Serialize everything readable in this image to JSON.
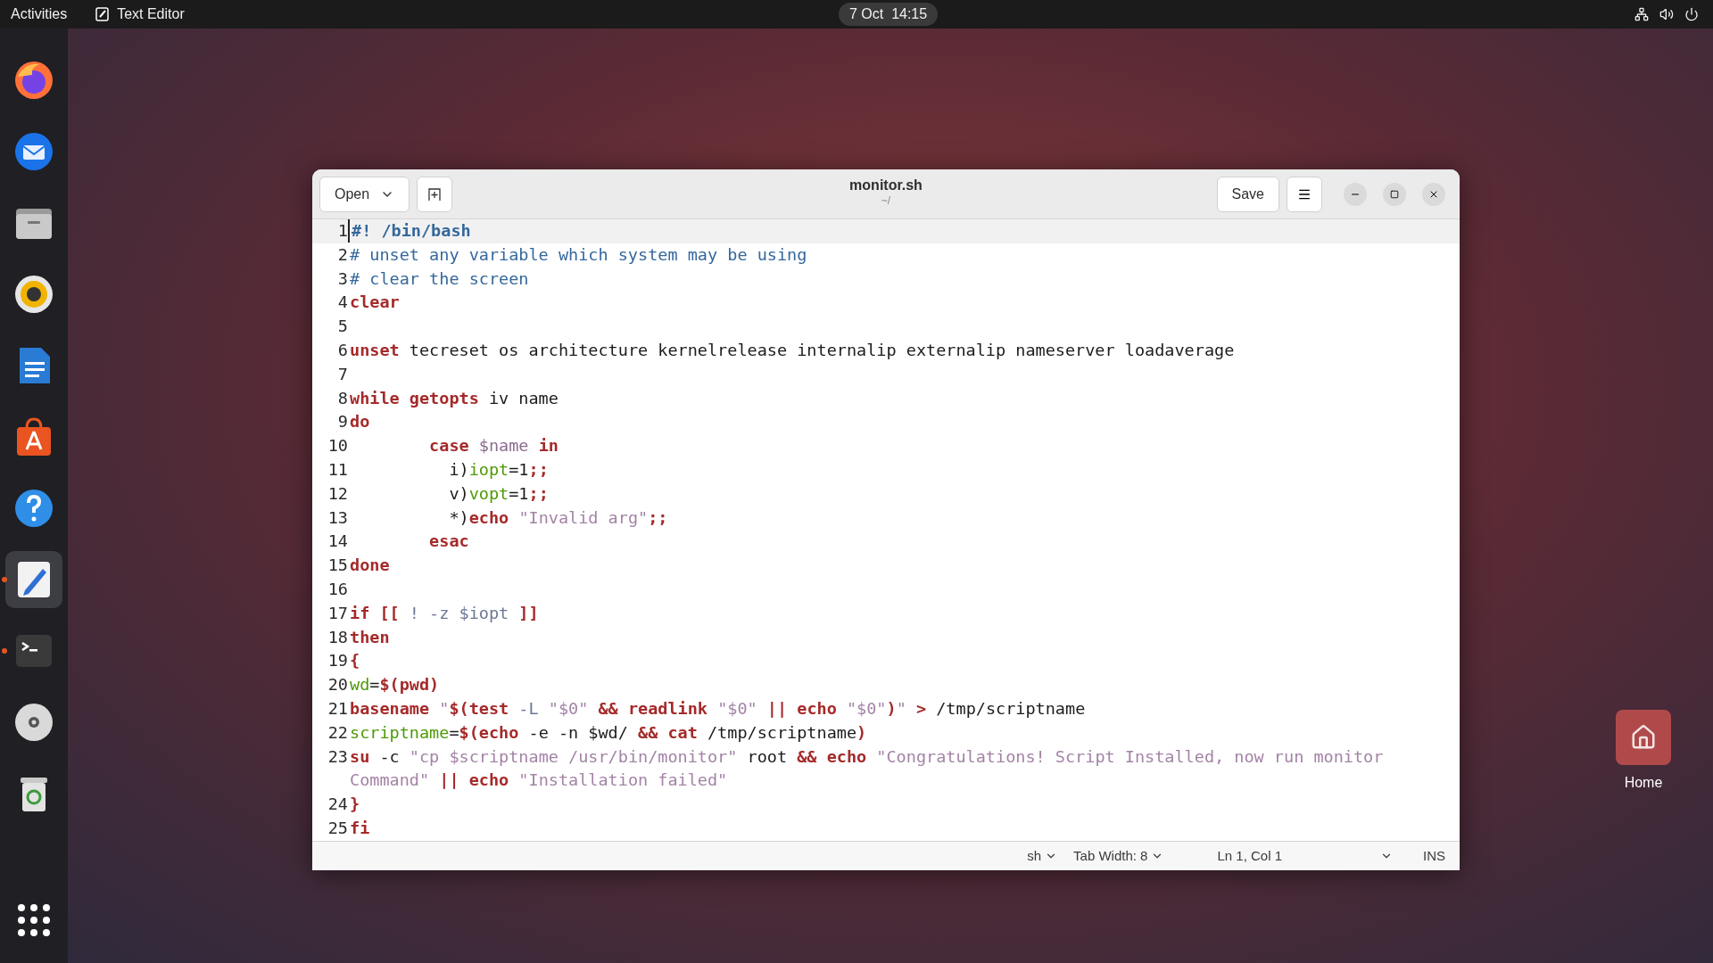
{
  "top_bar": {
    "activities": "Activities",
    "app_name": "Text Editor",
    "clock": "7 Oct  14:15"
  },
  "dock": [
    {
      "kind": "browser",
      "running": false,
      "focused": false
    },
    {
      "kind": "mail",
      "running": false,
      "focused": false
    },
    {
      "kind": "files",
      "running": false,
      "focused": false
    },
    {
      "kind": "music",
      "running": false,
      "focused": false
    },
    {
      "kind": "document",
      "running": false,
      "focused": false
    },
    {
      "kind": "store",
      "running": false,
      "focused": false
    },
    {
      "kind": "help",
      "running": false,
      "focused": false
    },
    {
      "kind": "editor",
      "running": true,
      "focused": true
    },
    {
      "kind": "terminal",
      "running": true,
      "focused": false
    },
    {
      "kind": "disc",
      "running": false,
      "focused": false
    },
    {
      "kind": "trash",
      "running": false,
      "focused": false
    },
    {
      "kind": "grid",
      "running": false,
      "focused": false
    }
  ],
  "desktop_icons": [
    {
      "label": "Home"
    }
  ],
  "window": {
    "title": "monitor.sh",
    "subtitle": "~/",
    "open_button": "Open",
    "save_button": "Save",
    "lines": [
      {
        "number": "1",
        "current": true,
        "segments": [
          {
            "kind": "cmb",
            "text": "#! /bin/bash"
          }
        ]
      },
      {
        "number": "2",
        "current": false,
        "segments": [
          {
            "kind": "cm",
            "text": "# unset any variable which system may be using"
          }
        ]
      },
      {
        "number": "3",
        "current": false,
        "segments": [
          {
            "kind": "cm",
            "text": "# clear the screen"
          }
        ]
      },
      {
        "number": "4",
        "current": false,
        "segments": [
          {
            "kind": "kw",
            "text": "clear"
          }
        ]
      },
      {
        "number": "5",
        "current": false
      },
      {
        "number": "6",
        "current": false,
        "segments": [
          {
            "kind": "kw",
            "text": "unset"
          },
          {
            "kind": "plain",
            "text": " tecreset os architecture kernelrelease internalip externalip nameserver loadaverage"
          }
        ]
      },
      {
        "number": "7",
        "current": false
      },
      {
        "number": "8",
        "current": false,
        "segments": [
          {
            "kind": "kw",
            "text": "while "
          },
          {
            "kind": "kw",
            "text": "getopts"
          },
          {
            "kind": "plain",
            "text": " iv name"
          }
        ]
      },
      {
        "number": "9",
        "current": false,
        "segments": [
          {
            "kind": "kw",
            "text": "do"
          }
        ]
      },
      {
        "number": "10",
        "current": false,
        "segments": [
          {
            "kind": "kw",
            "text": "\tcase "
          },
          {
            "kind": "var",
            "text": "$name "
          },
          {
            "kind": "kw",
            "text": "in"
          }
        ]
      },
      {
        "number": "11",
        "current": false,
        "segments": [
          {
            "kind": "plain",
            "text": "\t  i)"
          },
          {
            "kind": "id",
            "text": "iopt"
          },
          {
            "kind": "plain",
            "text": "=1"
          },
          {
            "kind": "kw",
            "text": ";;"
          }
        ]
      },
      {
        "number": "12",
        "current": false,
        "segments": [
          {
            "kind": "plain",
            "text": "\t  v)"
          },
          {
            "kind": "id",
            "text": "vopt"
          },
          {
            "kind": "plain",
            "text": "=1"
          },
          {
            "kind": "kw",
            "text": ";;"
          }
        ]
      },
      {
        "number": "13",
        "current": false,
        "segments": [
          {
            "kind": "plain",
            "text": "\t  *)"
          },
          {
            "kind": "kw",
            "text": "echo "
          },
          {
            "kind": "str",
            "text": "\"Invalid arg\""
          },
          {
            "kind": "kw",
            "text": ";;"
          }
        ]
      },
      {
        "number": "14",
        "current": false,
        "segments": [
          {
            "kind": "kw",
            "text": "\tesac"
          }
        ]
      },
      {
        "number": "15",
        "current": false,
        "segments": [
          {
            "kind": "kw",
            "text": "done"
          }
        ]
      },
      {
        "number": "16",
        "current": false
      },
      {
        "number": "17",
        "current": false,
        "segments": [
          {
            "kind": "kw",
            "text": "if [["
          },
          {
            "kind": "opt",
            "text": " ! -z $iopt "
          },
          {
            "kind": "kw",
            "text": "]]"
          }
        ]
      },
      {
        "number": "18",
        "current": false,
        "segments": [
          {
            "kind": "kw",
            "text": "then"
          }
        ]
      },
      {
        "number": "19",
        "current": false,
        "segments": [
          {
            "kind": "kw",
            "text": "{"
          }
        ]
      },
      {
        "number": "20",
        "current": false,
        "segments": [
          {
            "kind": "id",
            "text": "wd"
          },
          {
            "kind": "plain",
            "text": "="
          },
          {
            "kind": "kw",
            "text": "$(pwd)"
          }
        ]
      },
      {
        "number": "21",
        "current": false,
        "segments": [
          {
            "kind": "kw",
            "text": "basename "
          },
          {
            "kind": "str",
            "text": "\""
          },
          {
            "kind": "kw",
            "text": "$(test "
          },
          {
            "kind": "opt",
            "text": "-L "
          },
          {
            "kind": "str",
            "text": "\"$0\" "
          },
          {
            "kind": "kw",
            "text": "&& readlink "
          },
          {
            "kind": "str",
            "text": "\"$0\" "
          },
          {
            "kind": "kw",
            "text": "|| echo "
          },
          {
            "kind": "str",
            "text": "\"$0\""
          },
          {
            "kind": "kw",
            "text": ")"
          },
          {
            "kind": "str",
            "text": "\" "
          },
          {
            "kind": "kw",
            "text": ">"
          },
          {
            "kind": "plain",
            "text": " /tmp/scriptname"
          }
        ]
      },
      {
        "number": "22",
        "current": false,
        "segments": [
          {
            "kind": "id",
            "text": "scriptname"
          },
          {
            "kind": "plain",
            "text": "="
          },
          {
            "kind": "kw",
            "text": "$(echo"
          },
          {
            "kind": "plain",
            "text": " -e -n $wd/ "
          },
          {
            "kind": "kw",
            "text": "&& cat"
          },
          {
            "kind": "plain",
            "text": " /tmp/scriptname"
          },
          {
            "kind": "kw",
            "text": ")"
          }
        ]
      },
      {
        "number": "23",
        "current": false,
        "segments": [
          {
            "kind": "kw",
            "text": "su"
          },
          {
            "kind": "plain",
            "text": " -c "
          },
          {
            "kind": "str",
            "text": "\"cp $scriptname /usr/bin/monitor\""
          },
          {
            "kind": "plain",
            "text": " root "
          },
          {
            "kind": "kw",
            "text": "&& echo "
          },
          {
            "kind": "str",
            "text": "\"Congratulations! Script Installed, now run monitor Command\" "
          },
          {
            "kind": "kw",
            "text": "|| echo "
          },
          {
            "kind": "str",
            "text": "\"Installation failed\""
          }
        ]
      },
      {
        "number": "24",
        "current": false,
        "segments": [
          {
            "kind": "kw",
            "text": "}"
          }
        ]
      },
      {
        "number": "25",
        "current": false,
        "segments": [
          {
            "kind": "kw",
            "text": "fi"
          }
        ]
      }
    ],
    "status_bar": {
      "language": "sh",
      "tab_width": "Tab Width: 8",
      "position": "Ln 1, Col 1",
      "mode": "INS"
    }
  }
}
